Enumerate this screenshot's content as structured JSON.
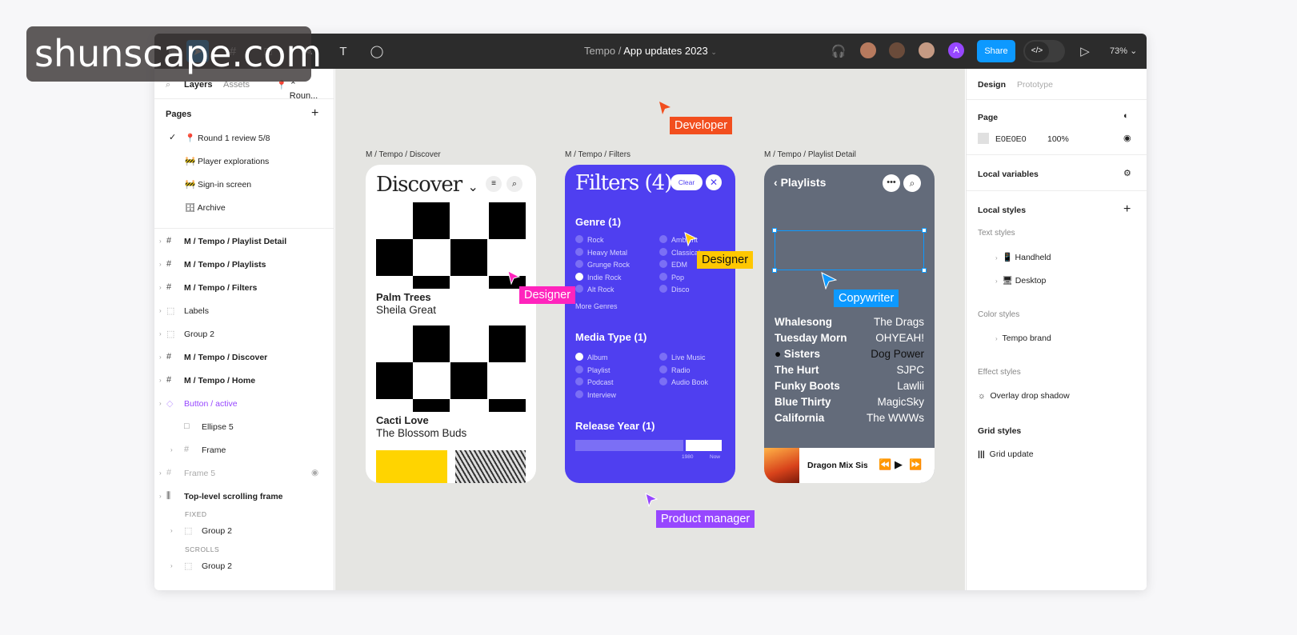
{
  "topbar": {
    "project": "Tempo",
    "separator": "/",
    "file": "App updates 2023",
    "share_label": "Share",
    "zoom": "73%",
    "devmode_label": "</>",
    "user_initial": "A"
  },
  "left_panel": {
    "tabs": [
      "Layers",
      "Assets"
    ],
    "page_selector": "Roun...",
    "pages_title": "Pages",
    "pages": [
      "Round 1 review 5/8",
      "Player explorations",
      "Sign-in screen",
      "Archive"
    ],
    "layers": [
      {
        "label": "M / Tempo / Playlist Detail",
        "icon": "#"
      },
      {
        "label": "M / Tempo / Playlists",
        "icon": "#"
      },
      {
        "label": "M / Tempo / Filters",
        "icon": "#"
      },
      {
        "label": "Labels",
        "icon": "⬚"
      },
      {
        "label": "Group 2",
        "icon": "⬚"
      },
      {
        "label": "M / Tempo / Discover",
        "icon": "#"
      },
      {
        "label": "M / Tempo / Home",
        "icon": "#"
      },
      {
        "label": "Button / active",
        "icon": "◇"
      },
      {
        "label": "Ellipse 5",
        "icon": "□"
      },
      {
        "label": "Frame",
        "icon": "#"
      },
      {
        "label": "Frame 5",
        "icon": "#"
      },
      {
        "label": "Top-level scrolling frame",
        "icon": "⫼"
      },
      {
        "label": "Group 2",
        "icon": "⬚"
      },
      {
        "label": "Group 2",
        "icon": "⬚"
      }
    ],
    "fixed_label": "FIXED",
    "scrolls_label": "SCROLLS"
  },
  "canvas": {
    "frame_labels": [
      "M / Tempo / Discover",
      "M / Tempo / Filters",
      "M / Tempo / Playlist Detail"
    ],
    "discover": {
      "title": "Discover",
      "items": [
        {
          "title": "Palm Trees",
          "artist": "Sheila Great"
        },
        {
          "title": "Cacti Love",
          "artist": "The Blossom Buds"
        }
      ]
    },
    "filters": {
      "title": "Filters (4)",
      "clear_label": "Clear",
      "genre_title": "Genre (1)",
      "genres_left": [
        "Rock",
        "Heavy Metal",
        "Grunge Rock",
        "Indie Rock",
        "Alt Rock"
      ],
      "genres_right": [
        "Ambient",
        "Classical",
        "EDM",
        "Pop",
        "Disco"
      ],
      "more_genres": "More Genres",
      "media_title": "Media Type (1)",
      "media_left": [
        "Album",
        "Playlist",
        "Podcast",
        "Interview"
      ],
      "media_right": [
        "Live Music",
        "Radio",
        "Audio Book"
      ],
      "year_title": "Release Year (1)",
      "year_from": "1980",
      "year_to": "Now"
    },
    "playlists": {
      "title": "Playlists",
      "rows": [
        {
          "a": "Whalesong",
          "b": "The Drags"
        },
        {
          "a": "Tuesday Morn",
          "b": "OHYEAH!"
        },
        {
          "a": "Sisters",
          "b": "Dog Power"
        },
        {
          "a": "The Hurt",
          "b": "SJPC"
        },
        {
          "a": "Funky Boots",
          "b": "Lawlii"
        },
        {
          "a": "Blue Thirty",
          "b": "MagicSky"
        },
        {
          "a": "California",
          "b": "The WWWs"
        }
      ],
      "now_playing": "Dragon Mix Sist"
    },
    "cursors": {
      "developer": "Developer",
      "designer1": "Designer",
      "designer2": "Designer",
      "copywriter": "Copywriter",
      "pm": "Product manager"
    }
  },
  "right_panel": {
    "tabs": [
      "Design",
      "Prototype"
    ],
    "page_title": "Page",
    "page_color": "E0E0E0",
    "page_opacity": "100%",
    "local_variables": "Local variables",
    "local_styles": "Local styles",
    "text_styles": "Text styles",
    "text_style_items": [
      "Handheld",
      "Desktop"
    ],
    "color_styles": "Color styles",
    "color_style_items": [
      "Tempo brand"
    ],
    "effect_styles": "Effect styles",
    "effect_style_items": [
      "Overlay drop shadow"
    ],
    "grid_styles": "Grid styles",
    "grid_style_items": [
      "Grid update"
    ]
  },
  "watermark": "shunscape.com",
  "colors": {
    "accent": "#0d99ff",
    "filters_bg": "#4f3ff0",
    "developer": "#f24e1e",
    "designer_pink": "#ff24bd",
    "designer_yellow": "#ffc700",
    "copywriter": "#0d99ff",
    "pm": "#9747ff"
  }
}
